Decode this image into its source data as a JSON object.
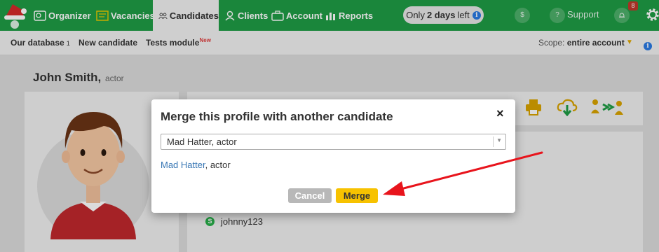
{
  "nav": {
    "items": [
      {
        "label": "Organizer"
      },
      {
        "label": "Vacancies"
      },
      {
        "label": "Candidates"
      },
      {
        "label": "Clients"
      },
      {
        "label": "Account"
      },
      {
        "label": "Reports"
      }
    ],
    "trial": {
      "prefix": "Only",
      "days": "2 days",
      "suffix": "left"
    },
    "support_label": "Support",
    "notification_count": "8",
    "billing_glyph": "$",
    "support_glyph": "?"
  },
  "subnav": {
    "database_label": "Our database",
    "database_count": "1",
    "new_candidate_label": "New candidate",
    "tests_label": "Tests module",
    "tests_badge": "New",
    "scope_prefix": "Scope:",
    "scope_value": "entire account"
  },
  "profile": {
    "name": "John Smith,",
    "role": "actor",
    "skype": "johnny123"
  },
  "modal": {
    "title": "Merge this profile with another candidate",
    "close_glyph": "×",
    "select_value": "Mad Hatter, actor",
    "match_name": "Mad Hatter",
    "match_role": ", actor",
    "cancel_label": "Cancel",
    "merge_label": "Merge"
  },
  "colors": {
    "brand_green": "#1f9d45",
    "accent_yellow": "#f7c200",
    "link_blue": "#3a78b5",
    "annotation_red": "#e8141c"
  },
  "icons": [
    "santa-hat-logo",
    "organizer-icon",
    "vacancies-icon",
    "candidates-icon",
    "clients-icon",
    "account-icon",
    "reports-icon",
    "info-icon",
    "dollar-icon",
    "question-icon",
    "bell-icon",
    "gear-icon",
    "print-icon",
    "download-icon",
    "merge-icon",
    "skype-icon",
    "close-icon",
    "chevron-down-icon"
  ]
}
